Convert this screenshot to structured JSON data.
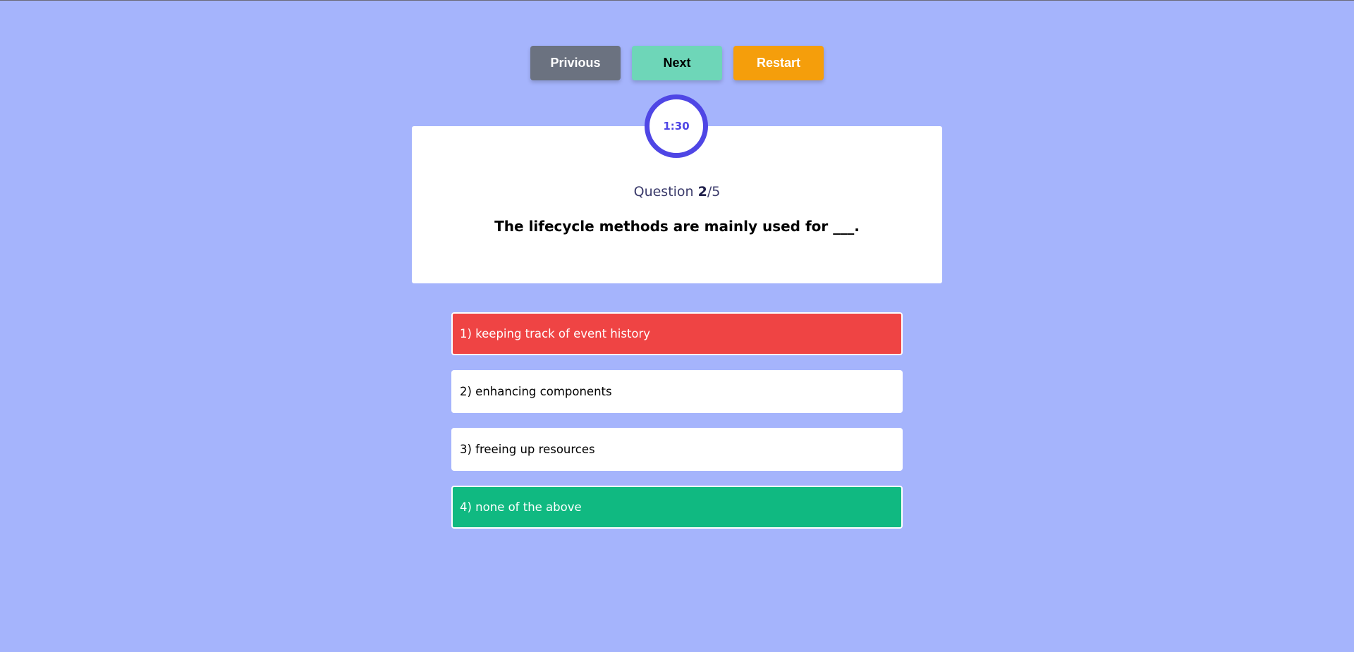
{
  "controls": {
    "previous_label": "Privious",
    "next_label": "Next",
    "restart_label": "Restart"
  },
  "timer": {
    "value": "1:30"
  },
  "question": {
    "prefix": "Question ",
    "current": "2",
    "total": "/5",
    "text": "The lifecycle methods are mainly used for ___."
  },
  "options": [
    {
      "label": "1) keeping track of event history",
      "state": "wrong"
    },
    {
      "label": "2) enhancing components",
      "state": "neutral"
    },
    {
      "label": "3) freeing up resources",
      "state": "neutral"
    },
    {
      "label": "4) none of the above",
      "state": "correct"
    }
  ],
  "colors": {
    "background": "#a5b4fc",
    "accent": "#4f46e5",
    "wrong": "#ef4444",
    "correct": "#10b981",
    "previous": "#6b7280",
    "next": "#6ed6b8",
    "restart": "#f59e0b"
  }
}
